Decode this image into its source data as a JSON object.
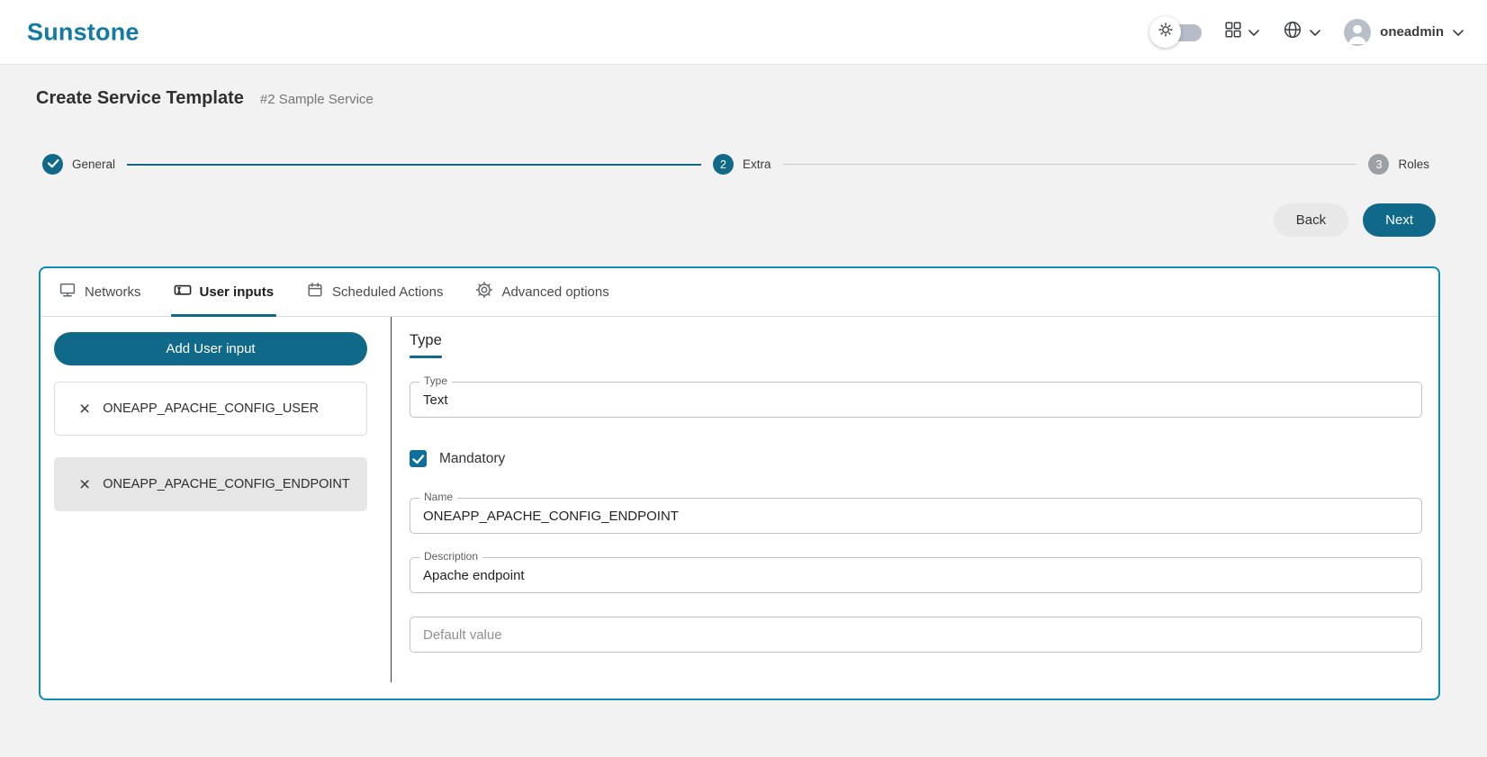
{
  "header": {
    "brand": "Sunstone",
    "username": "oneadmin",
    "controls": [
      {
        "name": "theme-toggle",
        "icon": "sun-icon",
        "state": "light"
      },
      {
        "name": "apps-menu",
        "icon": "grid-icon"
      },
      {
        "name": "language-menu",
        "icon": "globe-icon"
      },
      {
        "name": "user-menu",
        "icon": "avatar-icon",
        "label": "oneadmin"
      }
    ]
  },
  "page": {
    "title": "Create Service Template",
    "subtitle": "#2 Sample Service"
  },
  "stepper": {
    "steps": [
      {
        "label": "General",
        "state": "completed",
        "indicator": "check-icon"
      },
      {
        "label": "Extra",
        "state": "active",
        "number": "2"
      },
      {
        "label": "Roles",
        "state": "pending",
        "number": "3"
      }
    ]
  },
  "actions": {
    "back": "Back",
    "next": "Next"
  },
  "tabs": [
    {
      "label": "Networks",
      "icon": "network-screen-icon",
      "active": false
    },
    {
      "label": "User inputs",
      "icon": "text-input-icon",
      "active": true
    },
    {
      "label": "Scheduled Actions",
      "icon": "calendar-icon",
      "active": false
    },
    {
      "label": "Advanced options",
      "icon": "gear-icon",
      "active": false
    }
  ],
  "panel": {
    "add_button": "Add User input",
    "items": [
      {
        "label": "ONEAPP_APACHE_CONFIG_USER",
        "selected": false
      },
      {
        "label": "ONEAPP_APACHE_CONFIG_ENDPOINT",
        "selected": true
      }
    ]
  },
  "form": {
    "section_title": "Type",
    "type": {
      "label": "Type",
      "value": "Text"
    },
    "mandatory": {
      "label": "Mandatory",
      "checked": true
    },
    "name": {
      "label": "Name",
      "value": "ONEAPP_APACHE_CONFIG_ENDPOINT"
    },
    "description": {
      "label": "Description",
      "value": "Apache endpoint"
    },
    "default": {
      "placeholder": "Default value",
      "value": ""
    }
  },
  "glyphs": {
    "close": "×"
  },
  "colors": {
    "brand": "#1379A7",
    "primary": "#11698A",
    "container_border": "#0D8CB4",
    "step_pending": "#9AA0A6",
    "selected_item_bg": "#E6E6E6",
    "page_bg": "#F2F2F2"
  }
}
